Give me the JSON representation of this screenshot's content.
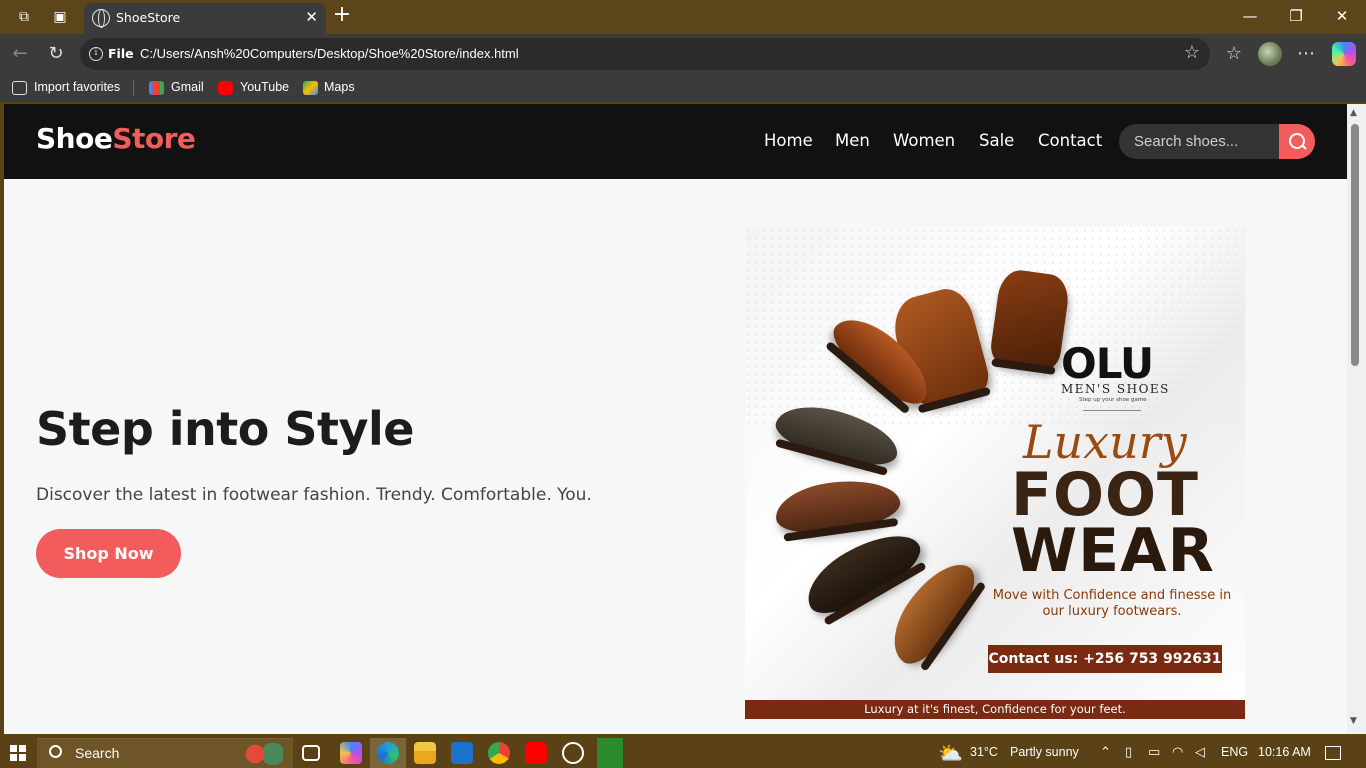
{
  "browser": {
    "tab_title": "ShoeStore",
    "scheme_label": "File",
    "url": "C:/Users/Ansh%20Computers/Desktop/Shoe%20Store/index.html",
    "favorites": [
      {
        "label": "Import favorites"
      },
      {
        "label": "Gmail"
      },
      {
        "label": "YouTube"
      },
      {
        "label": "Maps"
      }
    ]
  },
  "site": {
    "logo_main": "Shoe",
    "logo_accent": "Store",
    "nav": [
      "Home",
      "Men",
      "Women",
      "Sale",
      "Contact"
    ],
    "search_placeholder": "Search shoes...",
    "hero_title": "Step into Style",
    "hero_subtitle": "Discover the latest in footwear fashion. Trendy. Comfortable. You.",
    "cta": "Shop Now",
    "accent_color": "#f25c5c"
  },
  "poster": {
    "brand": "OLU",
    "brand_sub": "MEN'S SHOES",
    "brand_tagline": "Step up your shoe game",
    "headline_script": "Luxury",
    "headline_1": "FOOT",
    "headline_2": "WEAR",
    "body": "Move with Confidence and finesse in our luxury footwears.",
    "contact": "Contact us: +256 753 992631",
    "footer": "Luxury at it's finest, Confidence for your feet."
  },
  "taskbar": {
    "search_label": "Search",
    "weather_temp": "31°C",
    "weather_desc": "Partly sunny",
    "language": "ENG",
    "time": "10:16 AM"
  }
}
